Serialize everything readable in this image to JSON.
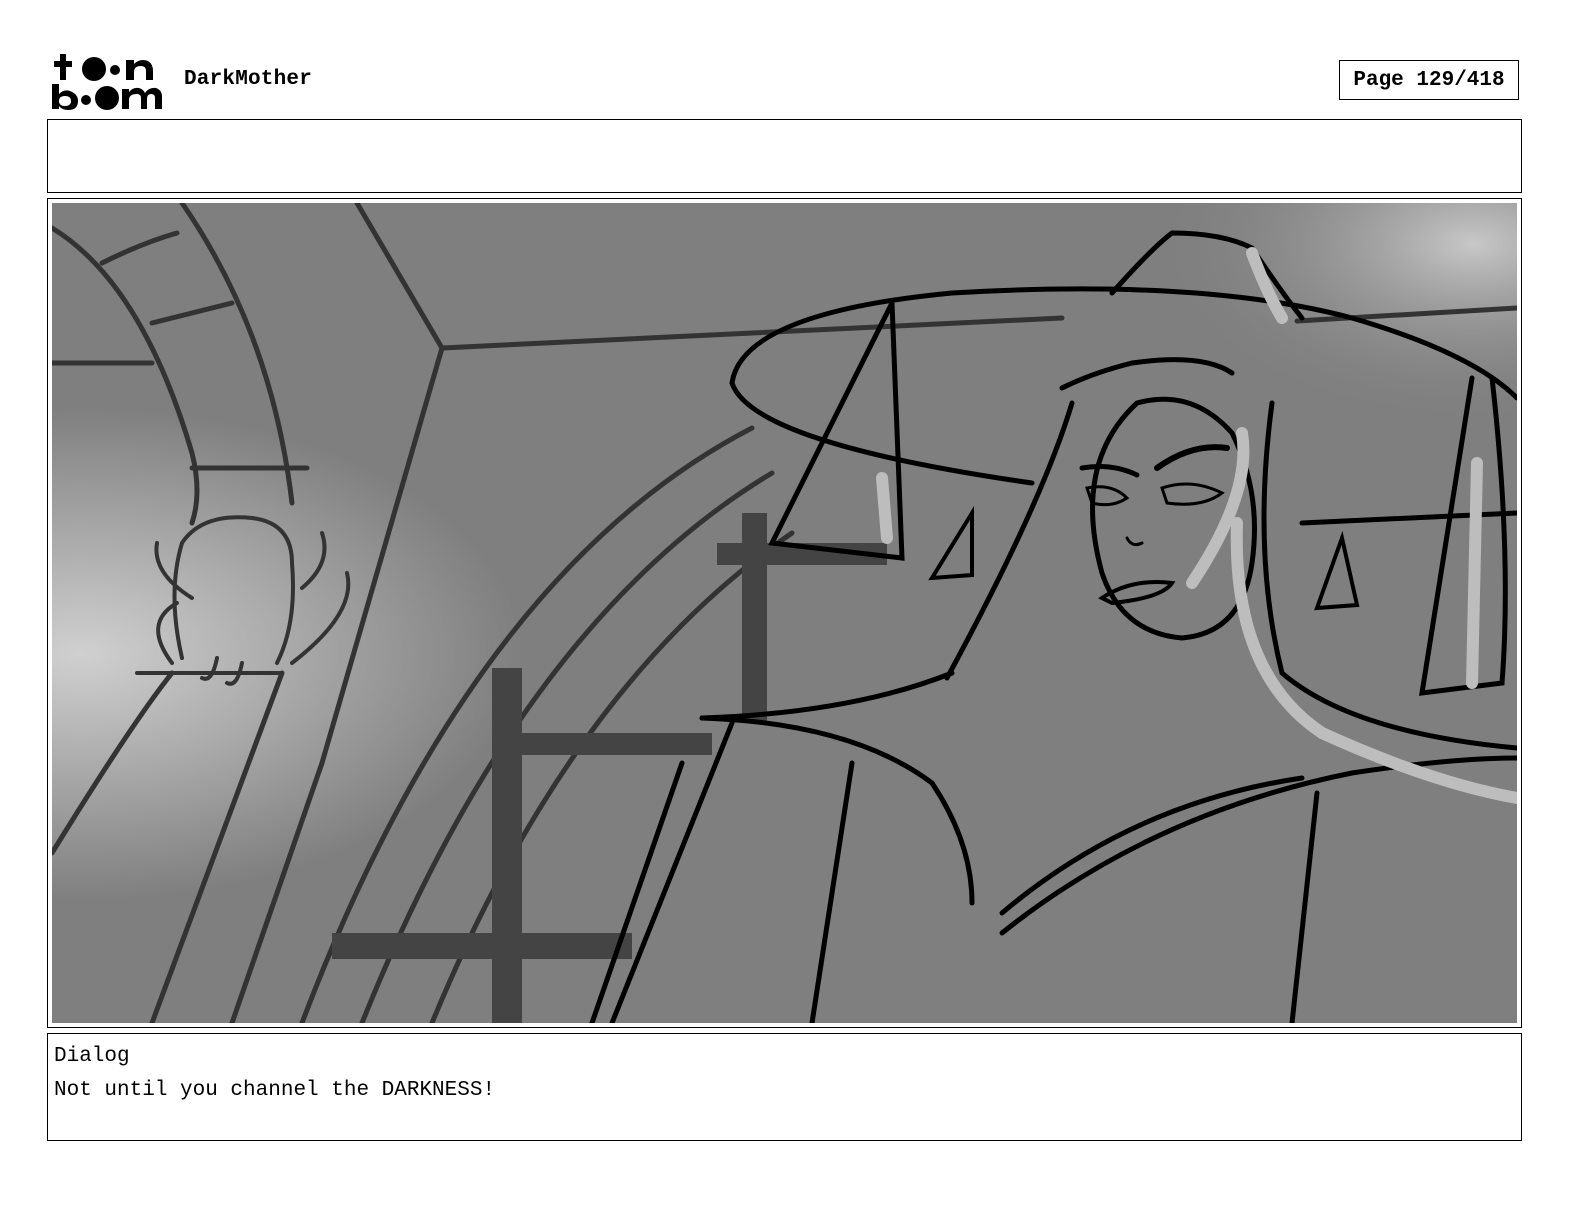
{
  "header": {
    "logo_text": "toon boom",
    "project_title": "DarkMother",
    "page_label": "Page 129/418"
  },
  "notes": {
    "text": ""
  },
  "panel": {
    "icon": "storyboard-sketch",
    "background_color": "#7f7f7f",
    "line_color": "#000000"
  },
  "dialog": {
    "label": "Dialog",
    "text": "Not until you channel the DARKNESS!"
  }
}
